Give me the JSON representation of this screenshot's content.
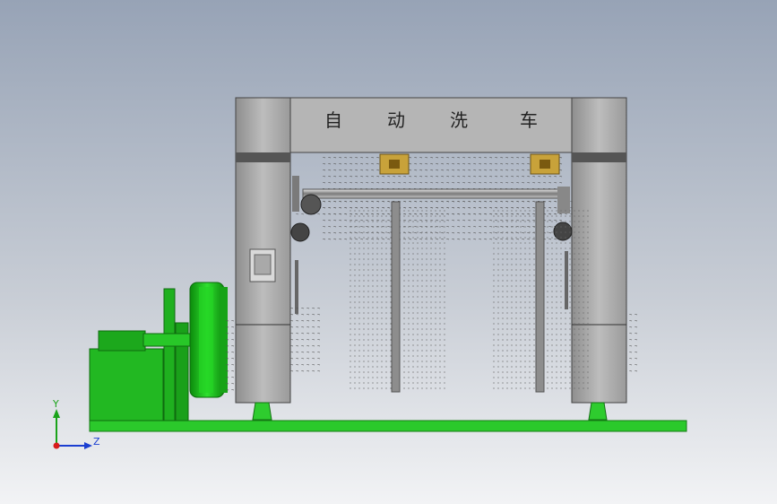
{
  "viewport": {
    "background_top": "#97a3b6",
    "background_bottom": "#f2f3f5"
  },
  "banner": {
    "chars": [
      "自",
      "动",
      "洗",
      "车"
    ]
  },
  "colors": {
    "frame": "#b0b0b0",
    "frame_dark": "#5a5a5a",
    "motor_green": "#1db31d",
    "base_green": "#2ecc2e",
    "brush_gray": "#8c8c8c",
    "gear_yellow": "#c8a23a"
  },
  "triad": {
    "y_label": "Y",
    "z_label": "Z"
  }
}
